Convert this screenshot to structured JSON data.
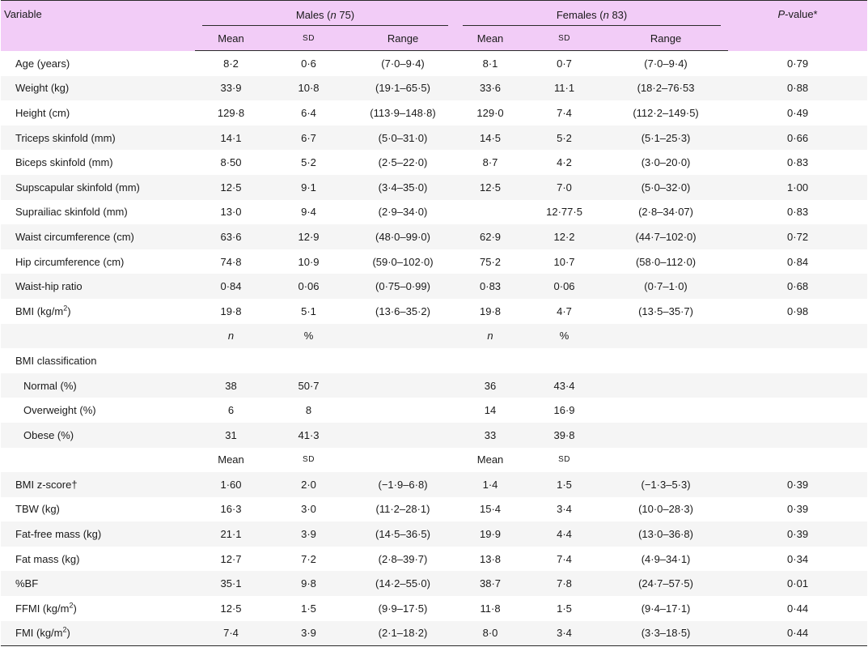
{
  "header": {
    "variable": "Variable",
    "males_label": "Males (",
    "males_n": "n",
    "males_count": " 75)",
    "females_label": "Females (",
    "females_n": "n",
    "females_count": " 83)",
    "pvalue_p": "P",
    "pvalue_rest": "-value*",
    "mean": "Mean",
    "sd": "SD",
    "range": "Range"
  },
  "rows1": [
    {
      "label": "Age (years)",
      "m_mean": "8·2",
      "m_sd": "0·6",
      "m_range": "(7·0–9·4)",
      "f_mean": "8·1",
      "f_sd": "0·7",
      "f_range": "(7·0–9·4)",
      "p": "0·79"
    },
    {
      "label": "Weight (kg)",
      "m_mean": "33·9",
      "m_sd": "10·8",
      "m_range": "(19·1–65·5)",
      "f_mean": "33·6",
      "f_sd": "11·1",
      "f_range": "(18·2–76·53",
      "p": "0·88"
    },
    {
      "label": "Height (cm)",
      "m_mean": "129·8",
      "m_sd": "6·4",
      "m_range": "(113·9–148·8)",
      "f_mean": "129·0",
      "f_sd": "7·4",
      "f_range": "(112·2–149·5)",
      "p": "0·49"
    },
    {
      "label": "Triceps skinfold (mm)",
      "m_mean": "14·1",
      "m_sd": "6·7",
      "m_range": "(5·0–31·0)",
      "f_mean": "14·5",
      "f_sd": "5·2",
      "f_range": "(5·1–25·3)",
      "p": "0·66"
    },
    {
      "label": "Biceps skinfold (mm)",
      "m_mean": "8·50",
      "m_sd": "5·2",
      "m_range": "(2·5–22·0)",
      "f_mean": "8·7",
      "f_sd": "4·2",
      "f_range": "(3·0–20·0)",
      "p": "0·83"
    },
    {
      "label": "Supscapular skinfold (mm)",
      "m_mean": "12·5",
      "m_sd": "9·1",
      "m_range": "(3·4–35·0)",
      "f_mean": "12·5",
      "f_sd": "7·0",
      "f_range": "(5·0–32·0)",
      "p": "1·00"
    },
    {
      "label": "Suprailiac skinfold (mm)",
      "m_mean": "13·0",
      "m_sd": "9·4",
      "m_range": "(2·9–34·0)",
      "f_mean": "",
      "f_sd": "12·77·5",
      "f_range": "(2·8–34·07)",
      "p": "0·83"
    },
    {
      "label": "Waist circumference (cm)",
      "m_mean": "63·6",
      "m_sd": "12·9",
      "m_range": "(48·0–99·0)",
      "f_mean": "62·9",
      "f_sd": "12·2",
      "f_range": "(44·7–102·0)",
      "p": "0·72"
    },
    {
      "label": "Hip circumference (cm)",
      "m_mean": "74·8",
      "m_sd": "10·9",
      "m_range": "(59·0–102·0)",
      "f_mean": "75·2",
      "f_sd": "10·7",
      "f_range": "(58·0–112·0)",
      "p": "0·84"
    },
    {
      "label": "Waist-hip ratio",
      "m_mean": "0·84",
      "m_sd": "0·06",
      "m_range": "(0·75–0·99)",
      "f_mean": "0·83",
      "f_sd": "0·06",
      "f_range": "(0·7–1·0)",
      "p": "0·68"
    }
  ],
  "bmi_row": {
    "label_pre": "BMI (kg/m",
    "label_sup": "2",
    "label_post": ")",
    "m_mean": "19·8",
    "m_sd": "5·1",
    "m_range": "(13·6–35·2)",
    "f_mean": "19·8",
    "f_sd": "4·7",
    "f_range": "(13·5–35·7)",
    "p": "0·98"
  },
  "n_header": {
    "n": "n",
    "pct": "%"
  },
  "bmi_class": {
    "label": "BMI classification",
    "items": [
      {
        "label": "Normal (%)",
        "m_n": "38",
        "m_pct": "50·7",
        "f_n": "36",
        "f_pct": "43·4"
      },
      {
        "label": "Overweight (%)",
        "m_n": "6",
        "m_pct": "8",
        "f_n": "14",
        "f_pct": "16·9"
      },
      {
        "label": "Obese (%)",
        "m_n": "31",
        "m_pct": "41·3",
        "f_n": "33",
        "f_pct": "39·8"
      }
    ]
  },
  "rows2": [
    {
      "label": "BMI z-score†",
      "m_mean": "1·60",
      "m_sd": "2·0",
      "m_range": "(−1·9–6·8)",
      "f_mean": "1·4",
      "f_sd": "1·5",
      "f_range": "(−1·3–5·3)",
      "p": "0·39"
    },
    {
      "label": "TBW (kg)",
      "m_mean": "16·3",
      "m_sd": "3·0",
      "m_range": "(11·2–28·1)",
      "f_mean": "15·4",
      "f_sd": "3·4",
      "f_range": "(10·0–28·3)",
      "p": "0·39"
    },
    {
      "label": "Fat-free mass (kg)",
      "m_mean": "21·1",
      "m_sd": "3·9",
      "m_range": "(14·5–36·5)",
      "f_mean": "19·9",
      "f_sd": "4·4",
      "f_range": "(13·0–36·8)",
      "p": "0·39"
    },
    {
      "label": "Fat mass (kg)",
      "m_mean": "12·7",
      "m_sd": "7·2",
      "m_range": "(2·8–39·7)",
      "f_mean": "13·8",
      "f_sd": "7·4",
      "f_range": "(4·9–34·1)",
      "p": "0·34"
    },
    {
      "label": "%BF",
      "m_mean": "35·1",
      "m_sd": "9·8",
      "m_range": "(14·2–55·0)",
      "f_mean": "38·7",
      "f_sd": "7·8",
      "f_range": "(24·7–57·5)",
      "p": "0·01"
    }
  ],
  "ffmi_row": {
    "label_pre": "FFMI (kg/m",
    "label_sup": "2",
    "label_post": ")",
    "m_mean": "12·5",
    "m_sd": "1·5",
    "m_range": "(9·9–17·5)",
    "f_mean": "11·8",
    "f_sd": "1·5",
    "f_range": "(9·4–17·1)",
    "p": "0·44"
  },
  "fmi_row": {
    "label_pre": "FMI (kg/m",
    "label_sup": "2",
    "label_post": ")",
    "m_mean": "7·4",
    "m_sd": "3·9",
    "m_range": "(2·1–18·2)",
    "f_mean": "8·0",
    "f_sd": "3·4",
    "f_range": "(3·3–18·5)",
    "p": "0·44"
  }
}
